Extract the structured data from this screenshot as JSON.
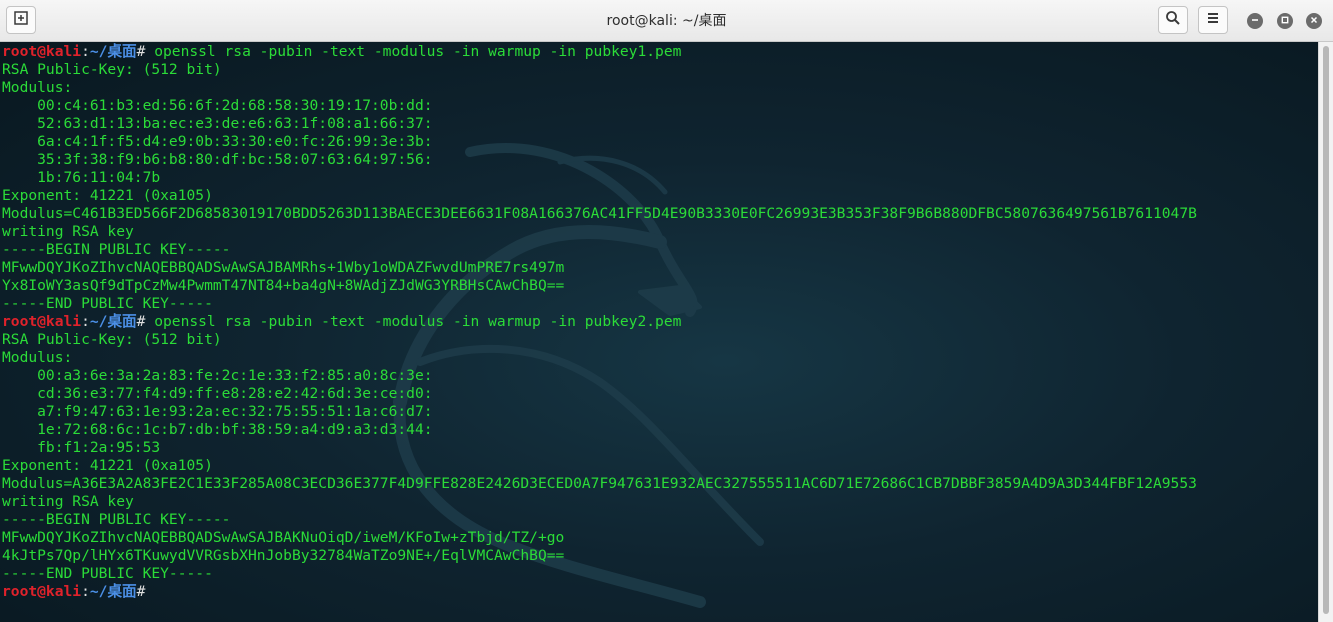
{
  "window": {
    "title": "root@kali: ~/桌面"
  },
  "icons": {
    "new_tab": "new-tab-icon",
    "search": "search-icon",
    "menu": "hamburger-menu-icon",
    "minimize": "minimize-icon",
    "maximize": "maximize-icon",
    "close": "close-icon"
  },
  "colors": {
    "prompt_user": "#e0222b",
    "prompt_path": "#4b8fe6",
    "output_text": "#2bdc38",
    "terminal_bg": "#0f2430"
  },
  "prompt": {
    "user_host": "root@kali",
    "colon": ":",
    "path": "~/桌面",
    "symbol": "# "
  },
  "terminal": {
    "lines": [
      {
        "type": "cmd",
        "text": "openssl rsa -pubin -text -modulus -in warmup -in pubkey1.pem"
      },
      {
        "type": "out",
        "text": "RSA Public-Key: (512 bit)"
      },
      {
        "type": "out",
        "text": "Modulus:"
      },
      {
        "type": "out",
        "text": "    00:c4:61:b3:ed:56:6f:2d:68:58:30:19:17:0b:dd:"
      },
      {
        "type": "out",
        "text": "    52:63:d1:13:ba:ec:e3:de:e6:63:1f:08:a1:66:37:"
      },
      {
        "type": "out",
        "text": "    6a:c4:1f:f5:d4:e9:0b:33:30:e0:fc:26:99:3e:3b:"
      },
      {
        "type": "out",
        "text": "    35:3f:38:f9:b6:b8:80:df:bc:58:07:63:64:97:56:"
      },
      {
        "type": "out",
        "text": "    1b:76:11:04:7b"
      },
      {
        "type": "out",
        "text": "Exponent: 41221 (0xa105)"
      },
      {
        "type": "out",
        "text": "Modulus=C461B3ED566F2D68583019170BDD5263D113BAECE3DEE6631F08A166376AC41FF5D4E90B3330E0FC26993E3B353F38F9B6B880DFBC5807636497561B7611047B"
      },
      {
        "type": "out",
        "text": "writing RSA key"
      },
      {
        "type": "out",
        "text": "-----BEGIN PUBLIC KEY-----"
      },
      {
        "type": "out",
        "text": "MFwwDQYJKoZIhvcNAQEBBQADSwAwSAJBAMRhs+1Wby1oWDAZFwvdUmPRE7rs497m"
      },
      {
        "type": "out",
        "text": "Yx8IoWY3asQf9dTpCzMw4PwmmT47NT84+ba4gN+8WAdjZJdWG3YRBHsCAwChBQ=="
      },
      {
        "type": "out",
        "text": "-----END PUBLIC KEY-----"
      },
      {
        "type": "cmd",
        "text": "openssl rsa -pubin -text -modulus -in warmup -in pubkey2.pem"
      },
      {
        "type": "out",
        "text": "RSA Public-Key: (512 bit)"
      },
      {
        "type": "out",
        "text": "Modulus:"
      },
      {
        "type": "out",
        "text": "    00:a3:6e:3a:2a:83:fe:2c:1e:33:f2:85:a0:8c:3e:"
      },
      {
        "type": "out",
        "text": "    cd:36:e3:77:f4:d9:ff:e8:28:e2:42:6d:3e:ce:d0:"
      },
      {
        "type": "out",
        "text": "    a7:f9:47:63:1e:93:2a:ec:32:75:55:51:1a:c6:d7:"
      },
      {
        "type": "out",
        "text": "    1e:72:68:6c:1c:b7:db:bf:38:59:a4:d9:a3:d3:44:"
      },
      {
        "type": "out",
        "text": "    fb:f1:2a:95:53"
      },
      {
        "type": "out",
        "text": "Exponent: 41221 (0xa105)"
      },
      {
        "type": "out",
        "text": "Modulus=A36E3A2A83FE2C1E33F285A08C3ECD36E377F4D9FFE828E2426D3ECED0A7F947631E932AEC327555511AC6D71E72686C1CB7DBBF3859A4D9A3D344FBF12A9553"
      },
      {
        "type": "out",
        "text": "writing RSA key"
      },
      {
        "type": "out",
        "text": "-----BEGIN PUBLIC KEY-----"
      },
      {
        "type": "out",
        "text": "MFwwDQYJKoZIhvcNAQEBBQADSwAwSAJBAKNuOiqD/iweM/KFoIw+zTbjd/TZ/+go"
      },
      {
        "type": "out",
        "text": "4kJtPs7Qp/lHYx6TKuwydVVRGsbXHnJobBy32784WaTZo9NE+/EqlVMCAwChBQ=="
      },
      {
        "type": "out",
        "text": "-----END PUBLIC KEY-----"
      },
      {
        "type": "cmd",
        "text": ""
      }
    ]
  }
}
